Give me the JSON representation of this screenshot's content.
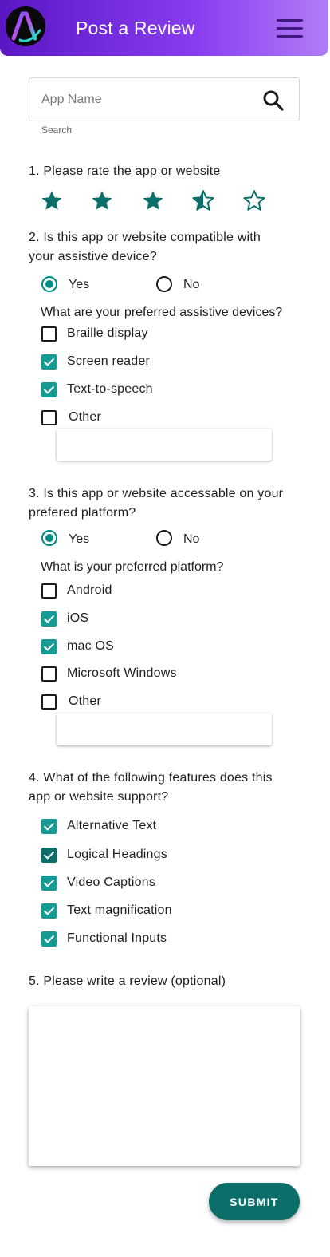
{
  "header": {
    "title": "Post a Review",
    "logo_letter": "A",
    "menu_icon": "hamburger-menu-icon",
    "gradient": [
      "#5b16c4",
      "#b27cf6"
    ]
  },
  "search": {
    "placeholder": "App Name",
    "helper": "Search",
    "icon": "search-icon"
  },
  "rating": {
    "question": "1. Please rate the app or website",
    "value": 3.5,
    "max": 5,
    "color": "#0b6e69"
  },
  "q2": {
    "question_line1": "2. Is this app or website compatible with",
    "question_line2": "your assistive device?",
    "yes_label": "Yes",
    "no_label": "No",
    "selected": "Yes",
    "sub_question": "What are your preferred assistive devices?",
    "options": [
      {
        "label": "Braille display",
        "checked": false
      },
      {
        "label": "Screen reader",
        "checked": true
      },
      {
        "label": "Text-to-speech",
        "checked": true
      },
      {
        "label": "Other",
        "checked": false
      }
    ]
  },
  "q3": {
    "question_line1": "3. Is this app or website accessable on your",
    "question_line2": "prefered platform?",
    "yes_label": "Yes",
    "no_label": "No",
    "selected": "Yes",
    "sub_question": "What is your preferred platform?",
    "options": [
      {
        "label": "Android",
        "checked": false
      },
      {
        "label": "iOS",
        "checked": true
      },
      {
        "label": "mac OS",
        "checked": true
      },
      {
        "label": "Microsoft Windows",
        "checked": false
      },
      {
        "label": "Other",
        "checked": false
      }
    ]
  },
  "q4": {
    "question_line1": "4. What of the following features does this",
    "question_line2": "app or website support?",
    "options": [
      {
        "label": "Alternative Text",
        "checked": true
      },
      {
        "label": "Logical Headings",
        "checked": true
      },
      {
        "label": "Video Captions",
        "checked": true
      },
      {
        "label": "Text magnification",
        "checked": true
      },
      {
        "label": "Functional Inputs",
        "checked": true
      }
    ]
  },
  "q5": {
    "question": "5. Please write a review (optional)"
  },
  "submit_label": "SUBMIT",
  "colors": {
    "accent": "#008a84",
    "checkbox": "#159a94",
    "button": "#0b6e69"
  }
}
